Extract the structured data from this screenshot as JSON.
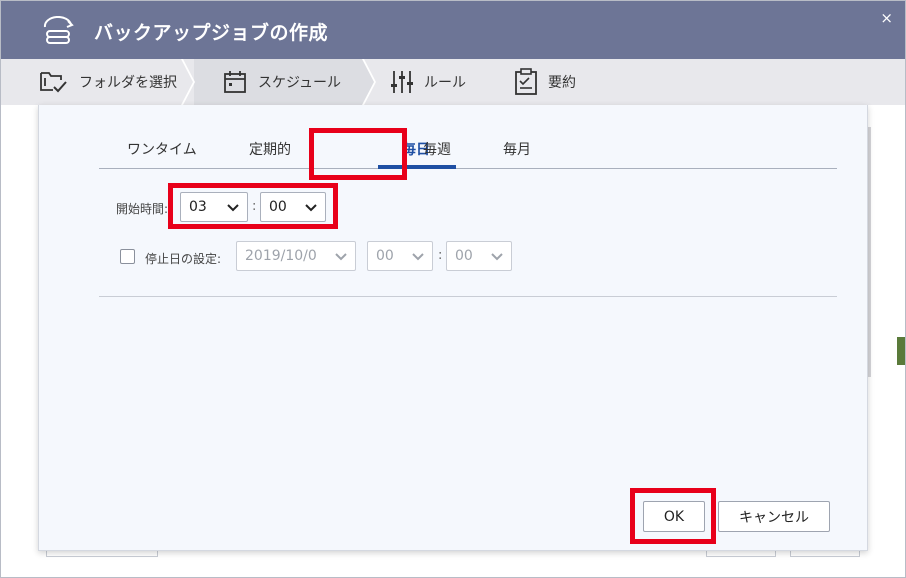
{
  "window": {
    "title": "バックアップジョブの作成",
    "close_glyph": "×"
  },
  "steps": [
    {
      "label": "フォルダを選択",
      "icon": "folder-check-icon"
    },
    {
      "label": "スケジュール",
      "icon": "calendar-icon"
    },
    {
      "label": "ルール",
      "icon": "sliders-icon"
    },
    {
      "label": "要約",
      "icon": "clipboard-icon"
    }
  ],
  "tabs": [
    {
      "label": "ワンタイム",
      "active": false
    },
    {
      "label": "定期的",
      "active": false
    },
    {
      "label": "毎日",
      "active": true
    },
    {
      "label": "毎週",
      "active": false
    },
    {
      "label": "毎月",
      "active": false
    }
  ],
  "start_time": {
    "label": "開始時間:",
    "hour": "03",
    "minute": "00",
    "separator": ":"
  },
  "stop_date": {
    "label": "停止日の設定:",
    "checked": false,
    "date": "2019/10/0",
    "hour": "00",
    "minute": "00",
    "separator": ":"
  },
  "buttons": {
    "ok": "OK",
    "cancel": "キャンセル"
  },
  "colors": {
    "titlebar": "#6d7596",
    "accent": "#1e4fa3",
    "highlight": "#e8001a"
  }
}
